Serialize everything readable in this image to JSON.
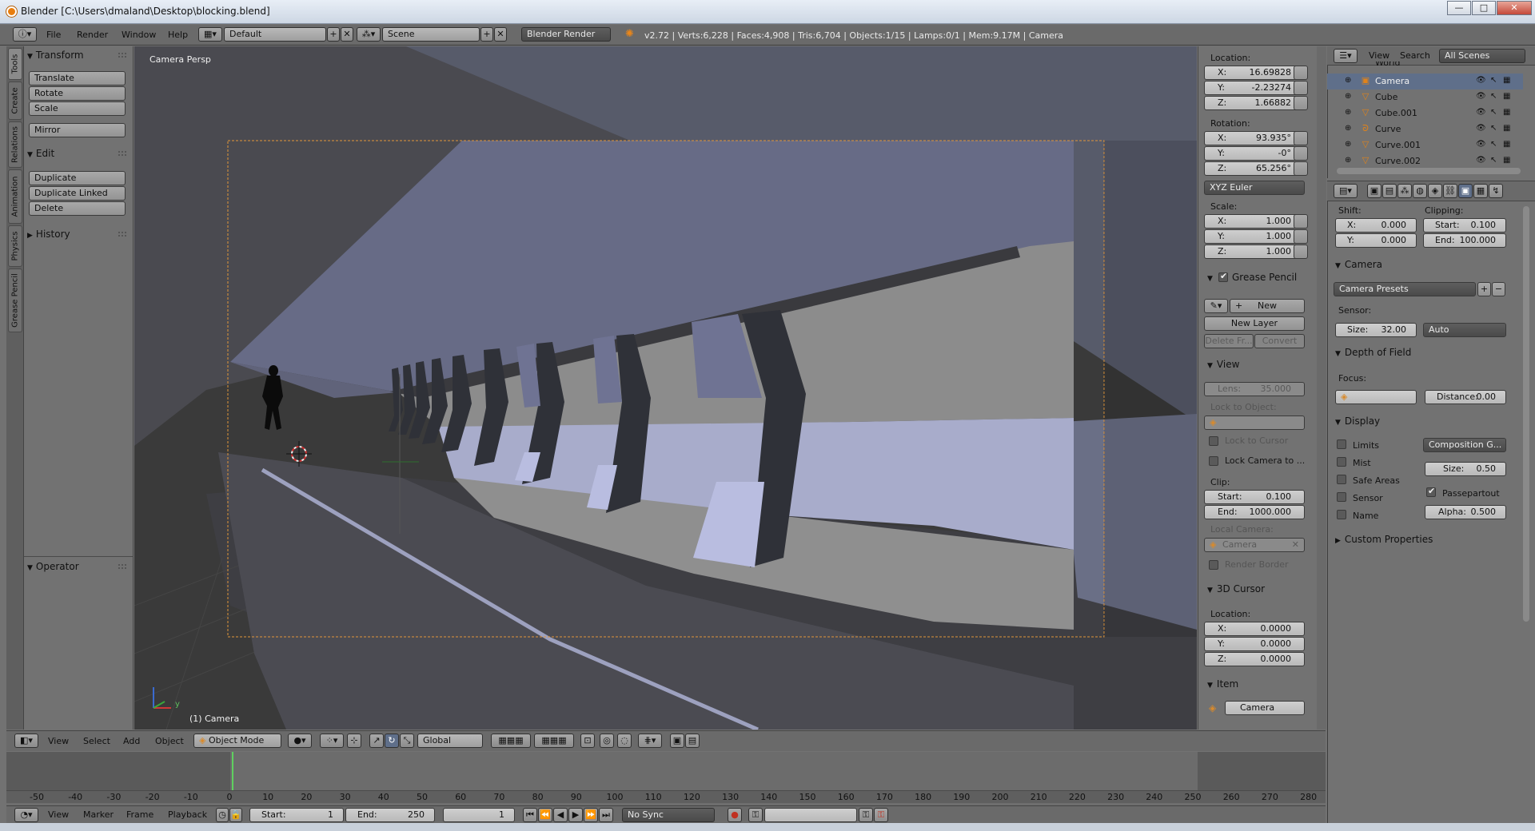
{
  "window": {
    "title": "Blender [C:\\Users\\dmaland\\Desktop\\blocking.blend]",
    "minimize": "—",
    "maximize": "□",
    "close": "✕"
  },
  "info_header": {
    "menus": [
      "File",
      "Render",
      "Window",
      "Help"
    ],
    "layout": "Default",
    "scene": "Scene",
    "engine": "Blender Render",
    "stats": "v2.72 | Verts:6,228 | Faces:4,908 | Tris:6,704 | Objects:1/15 | Lamps:0/1 | Mem:9.17M | Camera"
  },
  "tool_tabs": [
    "Tools",
    "Create",
    "Relations",
    "Animation",
    "Physics",
    "Grease Pencil"
  ],
  "tool_shelf": {
    "transform_title": "Transform",
    "transform_buttons": [
      "Translate",
      "Rotate",
      "Scale",
      "Mirror"
    ],
    "edit_title": "Edit",
    "edit_buttons": [
      "Duplicate",
      "Duplicate Linked",
      "Delete"
    ],
    "history_title": "History",
    "operator_title": "Operator"
  },
  "viewport": {
    "view_name": "Camera Persp",
    "object_label": "(1) Camera",
    "axis_y": "y"
  },
  "n_panel": {
    "location_title": "Location:",
    "location": [
      {
        "axis": "X:",
        "value": "16.69828"
      },
      {
        "axis": "Y:",
        "value": "-2.23274"
      },
      {
        "axis": "Z:",
        "value": "1.66882"
      }
    ],
    "rotation_title": "Rotation:",
    "rotation": [
      {
        "axis": "X:",
        "value": "93.935°"
      },
      {
        "axis": "Y:",
        "value": "-0°"
      },
      {
        "axis": "Z:",
        "value": "65.256°"
      }
    ],
    "rotation_mode": "XYZ Euler",
    "scale_title": "Scale:",
    "scale": [
      {
        "axis": "X:",
        "value": "1.000"
      },
      {
        "axis": "Y:",
        "value": "1.000"
      },
      {
        "axis": "Z:",
        "value": "1.000"
      }
    ],
    "grease_pencil_title": "Grease Pencil",
    "gp_new": "New",
    "gp_new_layer": "New Layer",
    "gp_delete_frame": "Delete Fr...",
    "gp_convert": "Convert",
    "view_title": "View",
    "lens_label": "Lens:",
    "lens_value": "35.000",
    "lock_to_object": "Lock to Object:",
    "lock_to_cursor": "Lock to Cursor",
    "lock_camera": "Lock Camera to ...",
    "clip_title": "Clip:",
    "clip_start_label": "Start:",
    "clip_start": "0.100",
    "clip_end_label": "End:",
    "clip_end": "1000.000",
    "local_camera_title": "Local Camera:",
    "local_camera": "Camera",
    "render_border": "Render Border",
    "cursor_title": "3D Cursor",
    "cursor_location_title": "Location:",
    "cursor": [
      {
        "axis": "X:",
        "value": "0.0000"
      },
      {
        "axis": "Y:",
        "value": "0.0000"
      },
      {
        "axis": "Z:",
        "value": "0.0000"
      }
    ],
    "item_title": "Item",
    "item_name": "Camera"
  },
  "outliner": {
    "view_menu": "View",
    "search_menu": "Search",
    "filter": "All Scenes",
    "partial_top": "World",
    "rows": [
      {
        "name": "Camera",
        "icon": "camera-icon",
        "selected": true
      },
      {
        "name": "Cube",
        "icon": "mesh-icon",
        "selected": false
      },
      {
        "name": "Cube.001",
        "icon": "mesh-icon",
        "selected": false
      },
      {
        "name": "Curve",
        "icon": "curve-icon",
        "selected": false
      },
      {
        "name": "Curve.001",
        "icon": "mesh-icon",
        "selected": false
      },
      {
        "name": "Curve.002",
        "icon": "mesh-icon",
        "selected": false
      }
    ]
  },
  "properties": {
    "shift_title": "Shift:",
    "shift_x_label": "X:",
    "shift_x": "0.000",
    "shift_y_label": "Y:",
    "shift_y": "0.000",
    "clipping_title": "Clipping:",
    "clip_start_label": "Start:",
    "clip_start": "0.100",
    "clip_end_label": "End:",
    "clip_end": "100.000",
    "camera_title": "Camera",
    "camera_presets": "Camera Presets",
    "sensor_title": "Sensor:",
    "sensor_size_label": "Size:",
    "sensor_size": "32.00",
    "sensor_fit": "Auto",
    "dof_title": "Depth of Field",
    "focus_title": "Focus:",
    "distance_label": "Distance:",
    "distance": "0.00",
    "display_title": "Display",
    "display_checks": [
      "Limits",
      "Mist",
      "Safe Areas",
      "Sensor",
      "Name"
    ],
    "composition": "Composition G...",
    "display_size_label": "Size:",
    "display_size": "0.50",
    "passepartout": "Passepartout",
    "alpha_label": "Alpha:",
    "alpha": "0.500",
    "custom_props_title": "Custom Properties"
  },
  "viewport_header": {
    "menus": [
      "View",
      "Select",
      "Add",
      "Object"
    ],
    "mode": "Object Mode",
    "orientation": "Global"
  },
  "timeline": {
    "ticks": [
      "-50",
      "-40",
      "-30",
      "-20",
      "-10",
      "0",
      "10",
      "20",
      "30",
      "40",
      "50",
      "60",
      "70",
      "80",
      "90",
      "100",
      "110",
      "120",
      "130",
      "140",
      "150",
      "160",
      "170",
      "180",
      "190",
      "200",
      "210",
      "220",
      "230",
      "240",
      "250",
      "260",
      "270",
      "280"
    ],
    "menus": [
      "View",
      "Marker",
      "Frame",
      "Playback"
    ],
    "start_label": "Start:",
    "start": "1",
    "end_label": "End:",
    "end": "250",
    "current": "1",
    "sync": "No Sync",
    "transport": [
      "⏮",
      "⏪",
      "◀",
      "▶",
      "⏩",
      "⏭"
    ]
  }
}
